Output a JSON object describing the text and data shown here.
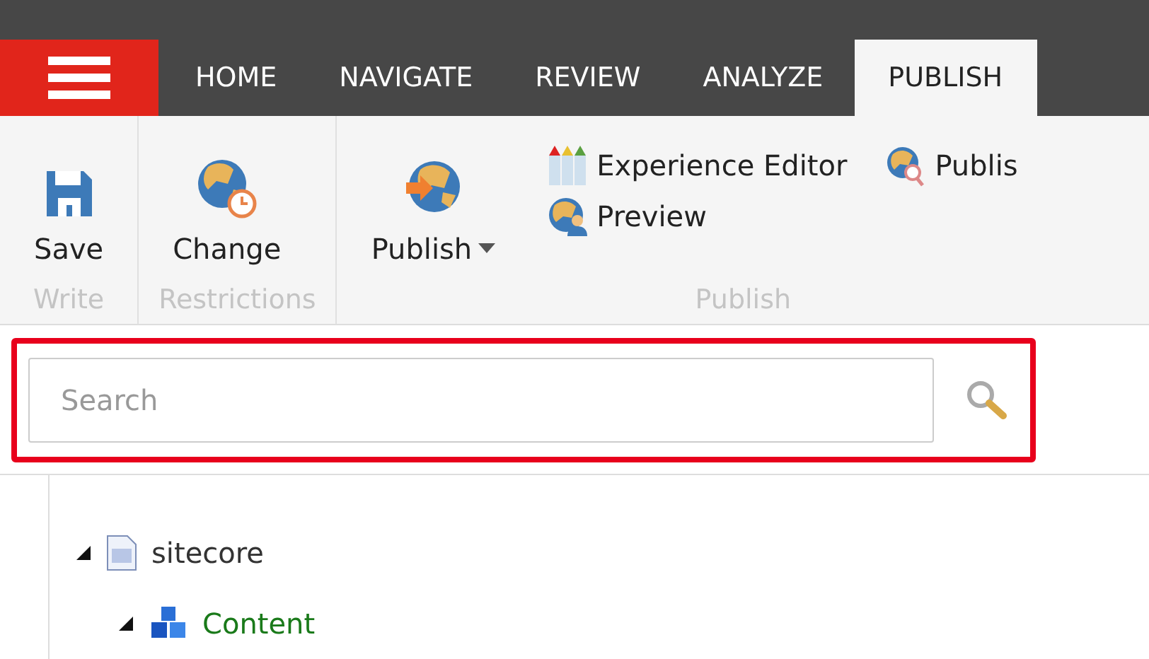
{
  "tabs": [
    {
      "label": "HOME",
      "selected": false
    },
    {
      "label": "NAVIGATE",
      "selected": false
    },
    {
      "label": "REVIEW",
      "selected": false
    },
    {
      "label": "ANALYZE",
      "selected": false
    },
    {
      "label": "PUBLISH",
      "selected": true
    }
  ],
  "ribbon": {
    "groups": [
      {
        "label": "Write",
        "columns": [
          [
            {
              "kind": "large",
              "label": "Save",
              "dropdown": false
            }
          ]
        ]
      },
      {
        "label": "Restrictions",
        "columns": [
          [
            {
              "kind": "large",
              "label": "Change",
              "dropdown": false
            }
          ]
        ]
      },
      {
        "label": "Publish",
        "columns": [
          [
            {
              "kind": "large",
              "label": "Publish",
              "dropdown": true
            }
          ],
          [
            {
              "kind": "small",
              "label": "Experience Editor"
            },
            {
              "kind": "small",
              "label": "Preview"
            }
          ],
          [
            {
              "kind": "small",
              "label": "Publis"
            }
          ]
        ]
      }
    ]
  },
  "search": {
    "placeholder": "Search",
    "highlighted": true
  },
  "tree": [
    {
      "label": "sitecore",
      "expanded": true,
      "color": "#333333",
      "children": [
        {
          "label": "Content",
          "expanded": true,
          "color": "#1a7a1a"
        }
      ]
    }
  ]
}
